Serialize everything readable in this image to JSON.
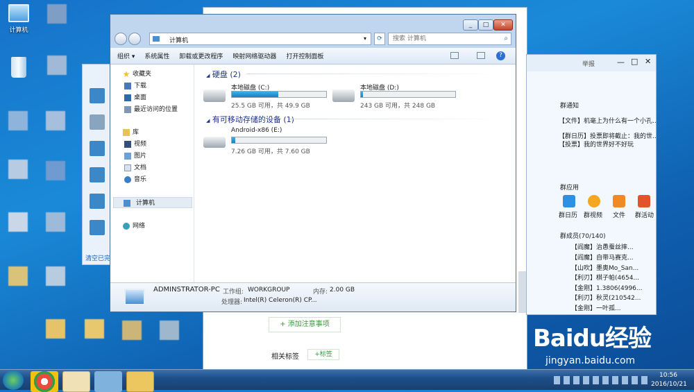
{
  "desktop": {
    "computer_label": "计算机"
  },
  "explorer": {
    "address": "计算机",
    "search_placeholder": "搜索 计算机",
    "toolbar": [
      "组织 ▾",
      "系统属性",
      "卸载或更改程序",
      "映射网络驱动器",
      "打开控制面板"
    ],
    "nav": {
      "favorites": "收藏夹",
      "downloads": "下载",
      "desktop": "桌面",
      "recent": "最近访问的位置",
      "libraries": "库",
      "videos": "视频",
      "pictures": "图片",
      "documents": "文档",
      "music": "音乐",
      "computer": "计算机",
      "network": "网络"
    },
    "hdd_header": "硬盘 (2)",
    "removable_header": "有可移动存储的设备 (1)",
    "drives": [
      {
        "name": "本地磁盘 (C:)",
        "info": "25.5 GB 可用，共 49.9 GB",
        "used": 0.49
      },
      {
        "name": "本地磁盘 (D:)",
        "info": "243 GB 可用，共 248 GB",
        "used": 0.02
      },
      {
        "name": "Android-x86 (E:)",
        "info": "7.26 GB 可用，共 7.60 GB",
        "used": 0.04
      }
    ],
    "details": {
      "pc_name": "ADMINSTRATOR-PC",
      "workgroup_label": "工作组:",
      "workgroup": "WORKGROUP",
      "memory_label": "内存:",
      "memory": "2.00 GB",
      "cpu_label": "处理器:",
      "cpu": "Intel(R) Celeron(R) CP..."
    }
  },
  "qq": {
    "report": "举报",
    "notice_title": "群通知",
    "notices": [
      "【文件】机毫上为什么有一个小孔...",
      "【群日历】投票即将截止：我的世...",
      "【投票】我的世界好不好玩"
    ],
    "apps_title": "群应用",
    "apps": [
      "群日历",
      "群视频",
      "文件",
      "群活动"
    ],
    "members_title": "群成员(70/140)",
    "members": [
      "【阎魔】治愚蚕丝摔...",
      "【阎魔】自带马赛克...",
      "【山吹】墨奥Mo_San...",
      "【利刃】棋子帕(4654...",
      "【金刚】1.3806(4996...",
      "【利刃】秋灵(210542...",
      "【金刚】一叶孤..."
    ]
  },
  "bg_window": {
    "add_note": "+ 添加注意事项",
    "related_tags": "相关标签",
    "tag_button": "+标签",
    "clear_link": "清空已完"
  },
  "taskbar": {
    "time": "10:56",
    "date": "2016/10/21"
  },
  "watermark": {
    "brand": "Baidu经验",
    "url": "jingyan.baidu.com"
  },
  "colors": {
    "accent": "#1d7ec3",
    "qq_header": "#d9ebf9",
    "taskbar": "#1e4f8a"
  }
}
